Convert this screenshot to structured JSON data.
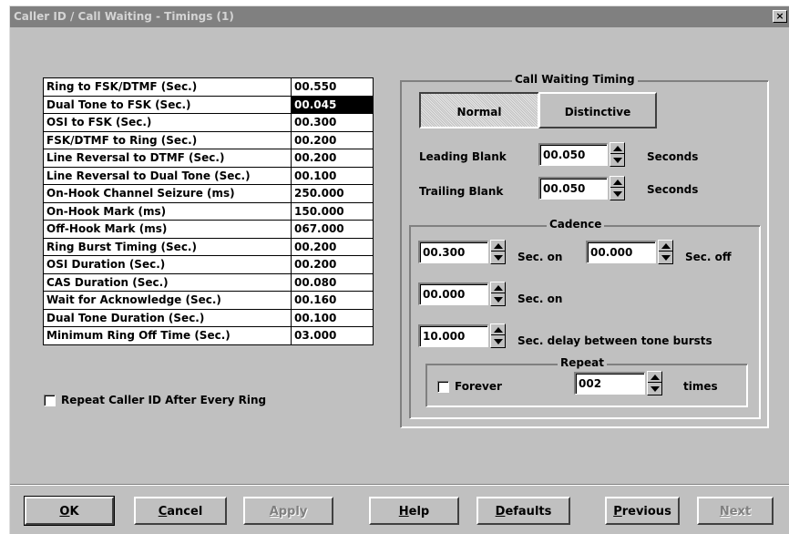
{
  "window": {
    "title": "Caller ID / Call Waiting - Timings (1)",
    "close_glyph": "×"
  },
  "timings": [
    {
      "label": "Ring to FSK/DTMF (Sec.)",
      "value": "00.550"
    },
    {
      "label": "Dual Tone to FSK (Sec.)",
      "value": "00.045",
      "selected": true
    },
    {
      "label": "OSI to FSK (Sec.)",
      "value": "00.300"
    },
    {
      "label": "FSK/DTMF to Ring (Sec.)",
      "value": "00.200"
    },
    {
      "label": "Line Reversal to DTMF (Sec.)",
      "value": "00.200"
    },
    {
      "label": "Line Reversal to Dual Tone (Sec.)",
      "value": "00.100"
    },
    {
      "label": "On-Hook Channel Seizure (ms)",
      "value": "250.000"
    },
    {
      "label": "On-Hook Mark (ms)",
      "value": "150.000"
    },
    {
      "label": "Off-Hook Mark (ms)",
      "value": "067.000"
    },
    {
      "label": "Ring Burst Timing (Sec.)",
      "value": "00.200"
    },
    {
      "label": "OSI Duration (Sec.)",
      "value": "00.200"
    },
    {
      "label": "CAS Duration (Sec.)",
      "value": "00.080"
    },
    {
      "label": "Wait for Acknowledge (Sec.)",
      "value": "00.160"
    },
    {
      "label": "Dual Tone Duration (Sec.)",
      "value": "00.100"
    },
    {
      "label": "Minimum Ring Off Time (Sec.)",
      "value": "03.000"
    }
  ],
  "repeat_caller_id": {
    "label": "Repeat Caller ID After Every Ring",
    "checked": false
  },
  "call_waiting": {
    "title": "Call Waiting Timing",
    "tabs": [
      "Normal",
      "Distinctive"
    ],
    "active_tab": "Normal",
    "leading_blank": {
      "label": "Leading Blank",
      "value": "00.050",
      "unit": "Seconds"
    },
    "trailing_blank": {
      "label": "Trailing Blank",
      "value": "00.050",
      "unit": "Seconds"
    }
  },
  "cadence": {
    "title": "Cadence",
    "on1": {
      "value": "00.300",
      "label": "Sec. on"
    },
    "off1": {
      "value": "00.000",
      "label": "Sec. off"
    },
    "on2": {
      "value": "00.000",
      "label": "Sec. on"
    },
    "delay": {
      "value": "10.000",
      "label": "Sec. delay between tone bursts"
    }
  },
  "repeat": {
    "title": "Repeat",
    "forever_label": "Forever",
    "forever_checked": false,
    "count": "002",
    "count_unit": "times"
  },
  "buttons": [
    {
      "key": "ok",
      "label": "OK",
      "mnemonic": "O",
      "rest": "K",
      "enabled": true
    },
    {
      "key": "cancel",
      "label": "Cancel",
      "mnemonic": "C",
      "rest": "ancel",
      "enabled": true
    },
    {
      "key": "apply",
      "label": "Apply",
      "mnemonic": "A",
      "rest": "pply",
      "enabled": false
    },
    {
      "key": "help",
      "label": "Help",
      "mnemonic": "H",
      "rest": "elp",
      "enabled": true
    },
    {
      "key": "defaults",
      "label": "Defaults",
      "mnemonic": "D",
      "rest": "efaults",
      "enabled": true
    },
    {
      "key": "previous",
      "label": "Previous",
      "mnemonic": "P",
      "rest": "revious",
      "enabled": true
    },
    {
      "key": "next",
      "label": "Next",
      "mnemonic": "N",
      "rest": "ext",
      "enabled": false
    }
  ]
}
